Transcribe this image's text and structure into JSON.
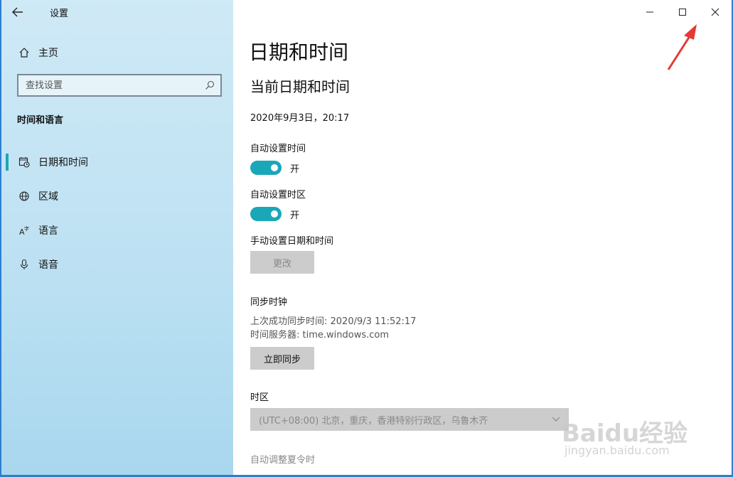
{
  "app": {
    "title": "设置"
  },
  "sidebar": {
    "home_label": "主页",
    "search_placeholder": "查找设置",
    "section_title": "时间和语言",
    "items": [
      {
        "label": "日期和时间",
        "icon": "calendar-clock-icon",
        "active": true
      },
      {
        "label": "区域",
        "icon": "globe-icon",
        "active": false
      },
      {
        "label": "语言",
        "icon": "language-icon",
        "active": false
      },
      {
        "label": "语音",
        "icon": "microphone-icon",
        "active": false
      }
    ]
  },
  "main": {
    "page_title": "日期和时间",
    "sub_title": "当前日期和时间",
    "current_datetime": "2020年9月3日，20:17",
    "auto_time": {
      "label": "自动设置时间",
      "state": "开"
    },
    "auto_timezone": {
      "label": "自动设置时区",
      "state": "开"
    },
    "manual": {
      "label": "手动设置日期和时间",
      "button": "更改"
    },
    "sync": {
      "title": "同步时钟",
      "last_sync": "上次成功同步时间: 2020/9/3 11:52:17",
      "server": "时间服务器: time.windows.com",
      "button": "立即同步"
    },
    "timezone": {
      "label": "时区",
      "value": "(UTC+08:00) 北京，重庆，香港特别行政区，乌鲁木齐"
    },
    "dst_label": "自动调整夏令时"
  },
  "colors": {
    "accent": "#1aa7b8",
    "annotation_arrow": "#e53935"
  },
  "watermark": {
    "line1": "Baidu经验",
    "line2": "jingyan.baidu.com"
  }
}
